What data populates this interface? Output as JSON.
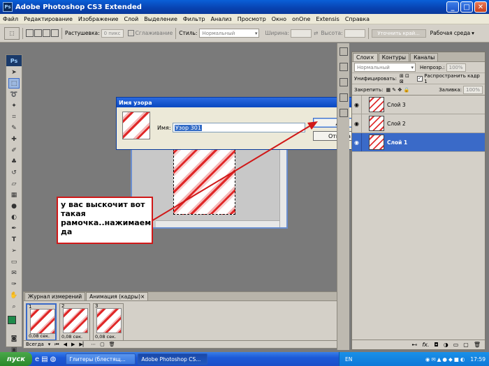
{
  "window": {
    "title": "Adobe Photoshop CS3 Extended"
  },
  "menu": [
    "Файл",
    "Редактирование",
    "Изображение",
    "Слой",
    "Выделение",
    "Фильтр",
    "Анализ",
    "Просмотр",
    "Окно",
    "onOne",
    "Extensis",
    "Справка"
  ],
  "options": {
    "feather_label": "Растушевка:",
    "feather_value": "0 пикс",
    "antialias_label": "Сглаживание",
    "style_label": "Стиль:",
    "style_value": "Нормальный",
    "width_label": "Ширина:",
    "height_label": "Высота:",
    "refine_button": "Уточнить край...",
    "workspace_label": "Рабочая среда"
  },
  "layers_panel": {
    "tabs": [
      "Слои",
      "Контуры",
      "Каналы"
    ],
    "blend_mode": "Нормальный",
    "opacity_label": "Непрозр.:",
    "opacity_value": "100%",
    "unify_label": "Унифицировать:",
    "propagate_label": "Распространить кадр 1",
    "lock_label": "Закрепить:",
    "fill_label": "Заливка:",
    "fill_value": "100%",
    "layers": [
      {
        "name": "Слой 3",
        "selected": false
      },
      {
        "name": "Слой 2",
        "selected": false
      },
      {
        "name": "Слой 1",
        "selected": true
      }
    ]
  },
  "dialog": {
    "title": "Имя узора",
    "name_label": "Имя:",
    "name_value": "Узор 301",
    "ok_button": "Да",
    "cancel_button": "Отмена"
  },
  "callout": {
    "text": "у вас выскочит вот такая рамочка..нажимаем да"
  },
  "animation_panel": {
    "tabs": [
      "Журнал измерений",
      "Анимация (кадры)"
    ],
    "frames": [
      {
        "number": "1",
        "time": "0,08 сек."
      },
      {
        "number": "2",
        "time": "0,08 сек."
      },
      {
        "number": "3",
        "time": "0,08 сек."
      }
    ],
    "loop_value": "Всегда"
  },
  "taskbar": {
    "start_label": "пуск",
    "items": [
      "Глитеры (блестящ...",
      "Adobe Photoshop CS..."
    ],
    "language": "EN",
    "time": "17:59"
  },
  "colors": {
    "accent": "#3a6ac8",
    "callout_border": "#d01818",
    "arrow": "#d01818"
  }
}
